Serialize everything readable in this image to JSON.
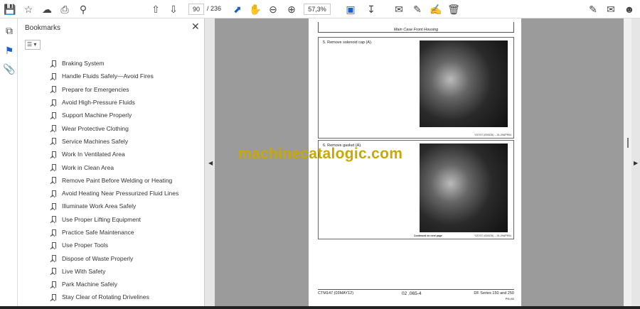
{
  "toolbar": {
    "page_current": "90",
    "page_total": "/ 236",
    "zoom": "57,3%",
    "icons": [
      "save-icon",
      "star-icon",
      "cloud-upload-icon",
      "print-icon",
      "zoom-search-icon",
      "page-up-icon",
      "page-down-icon",
      "select-cursor-icon",
      "hand-icon",
      "zoom-out-icon",
      "zoom-in-icon",
      "fit-page-icon",
      "scroll-mode-icon",
      "comment-icon",
      "pen-icon",
      "highlight-icon",
      "delete-icon",
      "sign-icon",
      "mail-icon",
      "account-icon"
    ]
  },
  "panel": {
    "title": "Bookmarks",
    "items": [
      "Braking System",
      "Handle Fluids Safely—Avoid Fires",
      "Prepare for Emergencies",
      "Avoid High-Pressure Fluids",
      "Support Machine Properly",
      "Wear Protective Clothing",
      "Service Machines Safely",
      "Work In Ventilated Area",
      "Work in Clean Area",
      "Remove Paint Before Welding or Heating",
      "Avoid Heating Near Pressurized Fluid Lines",
      "Illuminate Work Area Safely",
      "Use Proper Lifting Equipment",
      "Practice Safe Maintenance",
      "Use Proper Tools",
      "Dispose of Waste Properly",
      "Live With Safety",
      "Park Machine Safely",
      "Stay Clear of Rotating Drivelines"
    ]
  },
  "document": {
    "header": "Main Case Front Housing",
    "step5": "5.  Remove solenoid cap (A).",
    "step5_caption": "YZ0747 (000026) – 19–09APR04",
    "step6": "6.  Remove gasket (A).",
    "step6_continued": "Continued on next page",
    "step6_caption": "YZ0747 (000026) – 19–09APR04",
    "footer_left": "CTM147 (03MAY12)",
    "footer_center": "02 ,065-4",
    "footer_right": "DF Series 150 and 250",
    "footer_right_sub": "PN=80"
  },
  "watermark": "machinecatalogic.com"
}
